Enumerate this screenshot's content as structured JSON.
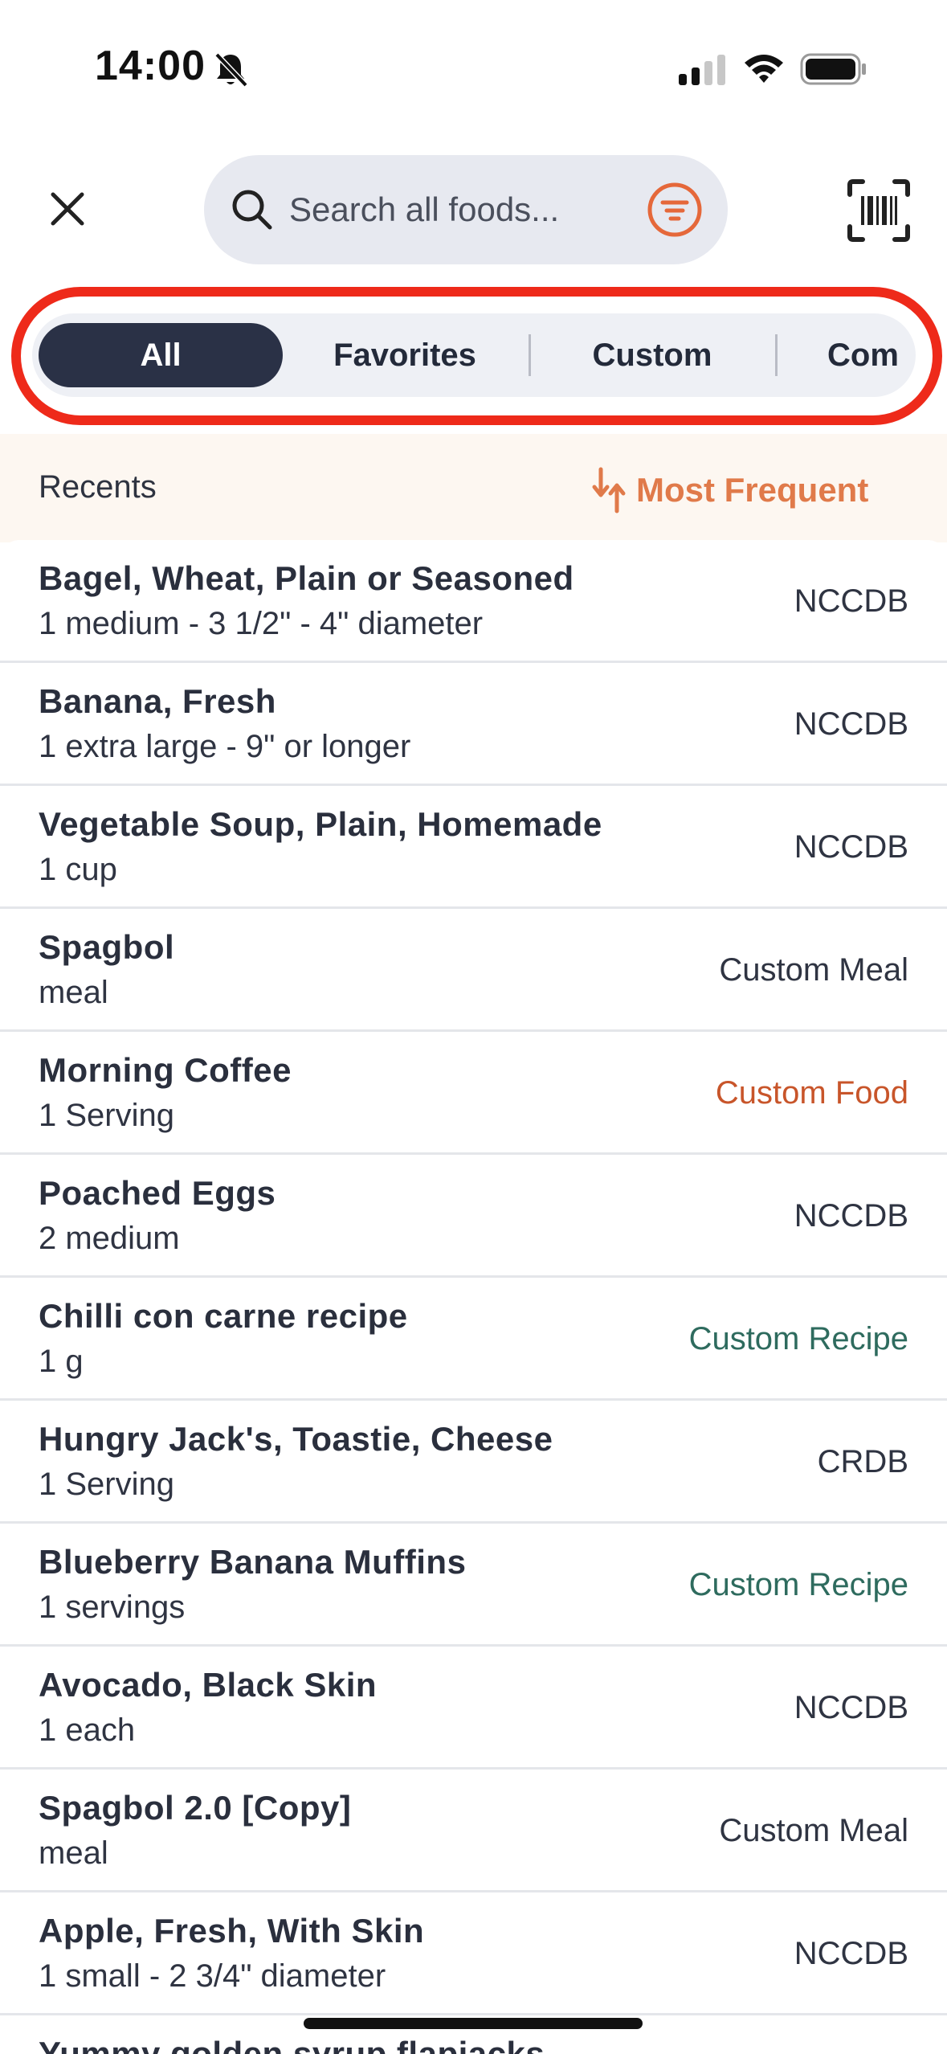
{
  "status_bar": {
    "time": "14:00"
  },
  "header": {
    "search_placeholder": "Search all foods..."
  },
  "tabs": [
    {
      "label": "All",
      "active": true
    },
    {
      "label": "Favorites",
      "active": false
    },
    {
      "label": "Custom",
      "active": false
    },
    {
      "label": "Com",
      "active": false
    }
  ],
  "recents": {
    "label": "Recents",
    "sort_label": "Most Frequent"
  },
  "colors": {
    "accent_orange": "#e07a4a",
    "custom_food": "#c8552a",
    "custom_recipe": "#2e6b5e",
    "highlight_red": "#ee2a1a",
    "tab_active": "#2a3146"
  },
  "foods": [
    {
      "name": "Bagel, Wheat, Plain or Seasoned",
      "serving": "1 medium - 3 1/2\" - 4\" diameter",
      "source": "NCCDB",
      "source_color": "#2f3442"
    },
    {
      "name": "Banana, Fresh",
      "serving": "1 extra large - 9\" or longer",
      "source": "NCCDB",
      "source_color": "#2f3442"
    },
    {
      "name": "Vegetable Soup, Plain, Homemade",
      "serving": "1 cup",
      "source": "NCCDB",
      "source_color": "#2f3442"
    },
    {
      "name": "Spagbol",
      "serving": "meal",
      "source": "Custom Meal",
      "source_color": "#2f3442"
    },
    {
      "name": "Morning Coffee",
      "serving": "1 Serving",
      "source": "Custom Food",
      "source_color": "#c8552a"
    },
    {
      "name": "Poached Eggs",
      "serving": "2 medium",
      "source": "NCCDB",
      "source_color": "#2f3442"
    },
    {
      "name": "Chilli con carne recipe",
      "serving": "1 g",
      "source": "Custom Recipe",
      "source_color": "#2e6b5e"
    },
    {
      "name": "Hungry Jack's, Toastie, Cheese",
      "serving": "1 Serving",
      "source": "CRDB",
      "source_color": "#2f3442"
    },
    {
      "name": "Blueberry Banana Muffins",
      "serving": "1 servings",
      "source": "Custom Recipe",
      "source_color": "#2e6b5e"
    },
    {
      "name": "Avocado, Black Skin",
      "serving": "1 each",
      "source": "NCCDB",
      "source_color": "#2f3442"
    },
    {
      "name": "Spagbol 2.0 [Copy]",
      "serving": "meal",
      "source": "Custom Meal",
      "source_color": "#2f3442"
    },
    {
      "name": "Apple, Fresh, With Skin",
      "serving": "1 small - 2 3/4\" diameter",
      "source": "NCCDB",
      "source_color": "#2f3442"
    },
    {
      "name": "Yummy golden syrup flapjacks",
      "serving": "",
      "source": "",
      "source_color": "#2f3442"
    }
  ]
}
